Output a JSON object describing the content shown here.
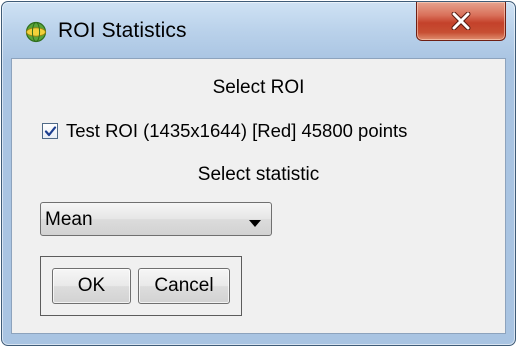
{
  "window": {
    "title": "ROI Statistics",
    "app_icon": "roi-app-icon",
    "close_icon": "close-x-icon"
  },
  "roi_section": {
    "label": "Select ROI",
    "items": [
      {
        "label": "Test ROI (1435x1644) [Red] 45800 points",
        "checked": true
      }
    ]
  },
  "statistic_section": {
    "label": "Select statistic",
    "selected_value": "Mean"
  },
  "buttons": {
    "ok_label": "OK",
    "cancel_label": "Cancel"
  },
  "colors": {
    "title_bar": "#b9d1ea",
    "close_button": "#c4412a",
    "client_background": "#f0f0f0"
  }
}
